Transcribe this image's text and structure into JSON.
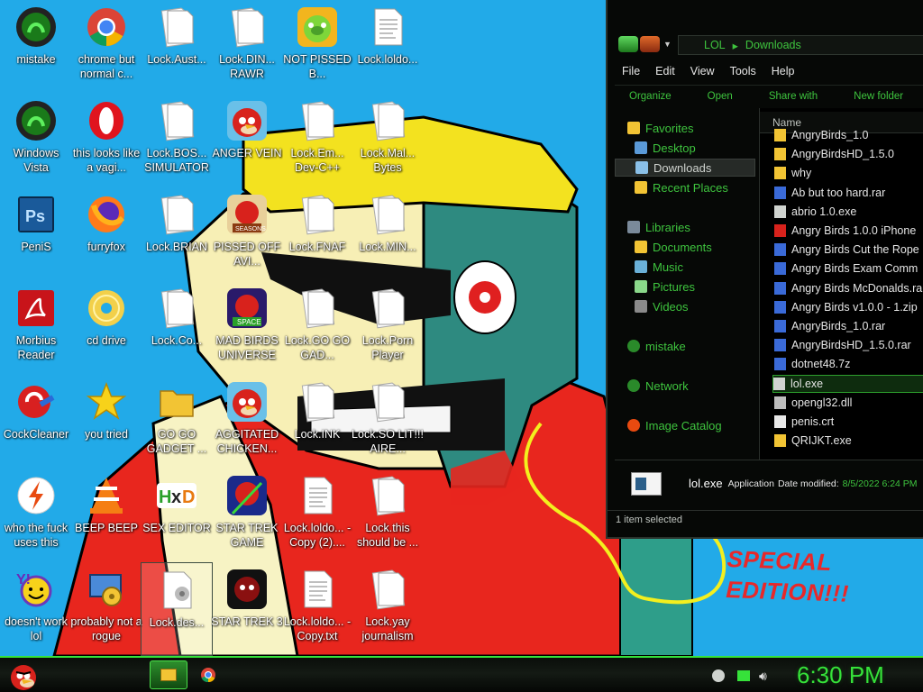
{
  "wallpaper": {
    "caption": "SPECIAL EDITION!!!"
  },
  "desktop_icons": [
    {
      "label": "mistake",
      "icon": "razer-icon"
    },
    {
      "label": "chrome but normal c...",
      "icon": "chrome-icon"
    },
    {
      "label": "Lock.Aust...",
      "icon": "blank-file-icon"
    },
    {
      "label": "Lock.DIN... RAWR",
      "icon": "blank-file-icon"
    },
    {
      "label": "NOT PISSED B...",
      "icon": "angry-birds-pig-icon"
    },
    {
      "label": "Lock.loldo...",
      "icon": "text-file-icon"
    },
    {
      "label": "Windows Vista",
      "icon": "razer-icon"
    },
    {
      "label": "this looks like a vagi...",
      "icon": "opera-icon"
    },
    {
      "label": "Lock.BOS... SIMULATOR",
      "icon": "blank-file-icon"
    },
    {
      "label": "ANGER VEIN",
      "icon": "angry-bird-icon"
    },
    {
      "label": "Lock.Em... Dev-C++",
      "icon": "blank-file-icon"
    },
    {
      "label": "Lock.Mal... Bytes",
      "icon": "blank-file-icon"
    },
    {
      "label": "PeniS",
      "icon": "photoshop-icon"
    },
    {
      "label": "furryfox",
      "icon": "firefox-icon"
    },
    {
      "label": "Lock.BRIAN",
      "icon": "blank-file-icon"
    },
    {
      "label": "PISSED OFF AVI...",
      "icon": "angry-birds-seasons-icon"
    },
    {
      "label": "Lock.FNAF",
      "icon": "blank-file-icon"
    },
    {
      "label": "Lock.MIN...",
      "icon": "blank-file-icon"
    },
    {
      "label": "Morbius Reader",
      "icon": "adobe-reader-icon"
    },
    {
      "label": "cd drive",
      "icon": "cd-drive-icon"
    },
    {
      "label": "Lock.Co...",
      "icon": "blank-file-icon"
    },
    {
      "label": "MAD BIRDS UNIVERSE",
      "icon": "angry-birds-space-icon"
    },
    {
      "label": "Lock.GO GO GAD...",
      "icon": "blank-file-icon"
    },
    {
      "label": "Lock.Porn Player",
      "icon": "blank-file-icon"
    },
    {
      "label": "CockCleaner",
      "icon": "ccleaner-icon"
    },
    {
      "label": "you tried",
      "icon": "star-icon"
    },
    {
      "label": "GO GO GADGET ...",
      "icon": "folder-icon"
    },
    {
      "label": "AGGITATED CHICKEN...",
      "icon": "angry-bird-icon"
    },
    {
      "label": "Lock.INK",
      "icon": "blank-file-icon"
    },
    {
      "label": "Lock.SO LIT!!! AIRE...",
      "icon": "blank-file-icon"
    },
    {
      "label": "who the fuck uses this",
      "icon": "flash-icon"
    },
    {
      "label": "BEEP BEEP",
      "icon": "vlc-icon"
    },
    {
      "label": "SEX EDITOR",
      "icon": "hxd-icon"
    },
    {
      "label": "STAR TREK GAME",
      "icon": "angry-birds-star-wars-icon"
    },
    {
      "label": "Lock.loldo... - Copy (2)....",
      "icon": "text-file-icon"
    },
    {
      "label": "Lock.this should be ...",
      "icon": "blank-file-icon"
    },
    {
      "label": "doesn't work lol",
      "icon": "yahoo-messenger-icon"
    },
    {
      "label": "probably not a rogue",
      "icon": "control-panel-icon"
    },
    {
      "label": "Lock.des...",
      "icon": "settings-file-icon"
    },
    {
      "label": "STAR TREK 3",
      "icon": "angry-birds-star-wars-2-icon"
    },
    {
      "label": "Lock.loldo... - Copy.txt",
      "icon": "text-file-icon"
    },
    {
      "label": "Lock.yay journalism",
      "icon": "blank-file-icon"
    }
  ],
  "explorer": {
    "breadcrumb": [
      "LOL",
      "Downloads"
    ],
    "menu": [
      "File",
      "Edit",
      "View",
      "Tools",
      "Help"
    ],
    "toolbar": [
      "Organize",
      "Open",
      "Share with",
      "New folder"
    ],
    "nav": [
      {
        "label": "Favorites",
        "icon": "favorites-star-icon"
      },
      {
        "label": "Desktop",
        "icon": "desktop-icon"
      },
      {
        "label": "Downloads",
        "icon": "downloads-icon"
      },
      {
        "label": "Recent Places",
        "icon": "recent-places-icon"
      },
      {
        "label": "Libraries",
        "icon": "libraries-icon"
      },
      {
        "label": "Documents",
        "icon": "documents-icon"
      },
      {
        "label": "Music",
        "icon": "music-icon"
      },
      {
        "label": "Pictures",
        "icon": "pictures-icon"
      },
      {
        "label": "Videos",
        "icon": "videos-icon"
      },
      {
        "label": "mistake",
        "icon": "homegroup-icon"
      },
      {
        "label": "Network",
        "icon": "network-icon"
      },
      {
        "label": "Image Catalog",
        "icon": "flash-icon"
      }
    ],
    "column_name": "Name",
    "files": [
      {
        "name": "AngryBirds_1.0",
        "icon": "folder-icon"
      },
      {
        "name": "AngryBirdsHD_1.5.0",
        "icon": "folder-icon"
      },
      {
        "name": "why",
        "icon": "folder-icon"
      },
      {
        "name": "Ab  but too hard.rar",
        "icon": "archive-icon"
      },
      {
        "name": "abrio 1.0.exe",
        "icon": "exe-icon"
      },
      {
        "name": "Angry Birds 1.0.0 iPhone",
        "icon": "angry-bird-icon"
      },
      {
        "name": "Angry Birds Cut the Rope",
        "icon": "archive-icon"
      },
      {
        "name": "Angry Birds Exam Comm",
        "icon": "archive-icon"
      },
      {
        "name": "Angry Birds McDonalds.ra",
        "icon": "archive-icon"
      },
      {
        "name": "Angry Birds v1.0.0 - 1.zip",
        "icon": "archive-icon"
      },
      {
        "name": "AngryBirds_1.0.rar",
        "icon": "archive-icon"
      },
      {
        "name": "AngryBirdsHD_1.5.0.rar",
        "icon": "archive-icon"
      },
      {
        "name": "dotnet48.7z",
        "icon": "archive-icon"
      },
      {
        "name": "lol.exe",
        "icon": "exe-icon"
      },
      {
        "name": "opengl32.dll",
        "icon": "dll-icon"
      },
      {
        "name": "penis.crt",
        "icon": "certificate-icon"
      },
      {
        "name": "QRIJKT.exe",
        "icon": "lock-icon"
      }
    ],
    "selected_file": "lol.exe",
    "details": {
      "name": "lol.exe",
      "type": "Application",
      "modified_label": "Date modified:",
      "modified_value": "8/5/2022 6:24 PM"
    },
    "status": "1 item selected"
  },
  "taskbar": {
    "clock": "6:30 PM",
    "pinned": [
      "explorer-icon",
      "chrome-icon"
    ]
  },
  "colors": {
    "accent_green": "#36e23a",
    "desktop_blue": "#22aae8",
    "explorer_bg": "#060806"
  }
}
